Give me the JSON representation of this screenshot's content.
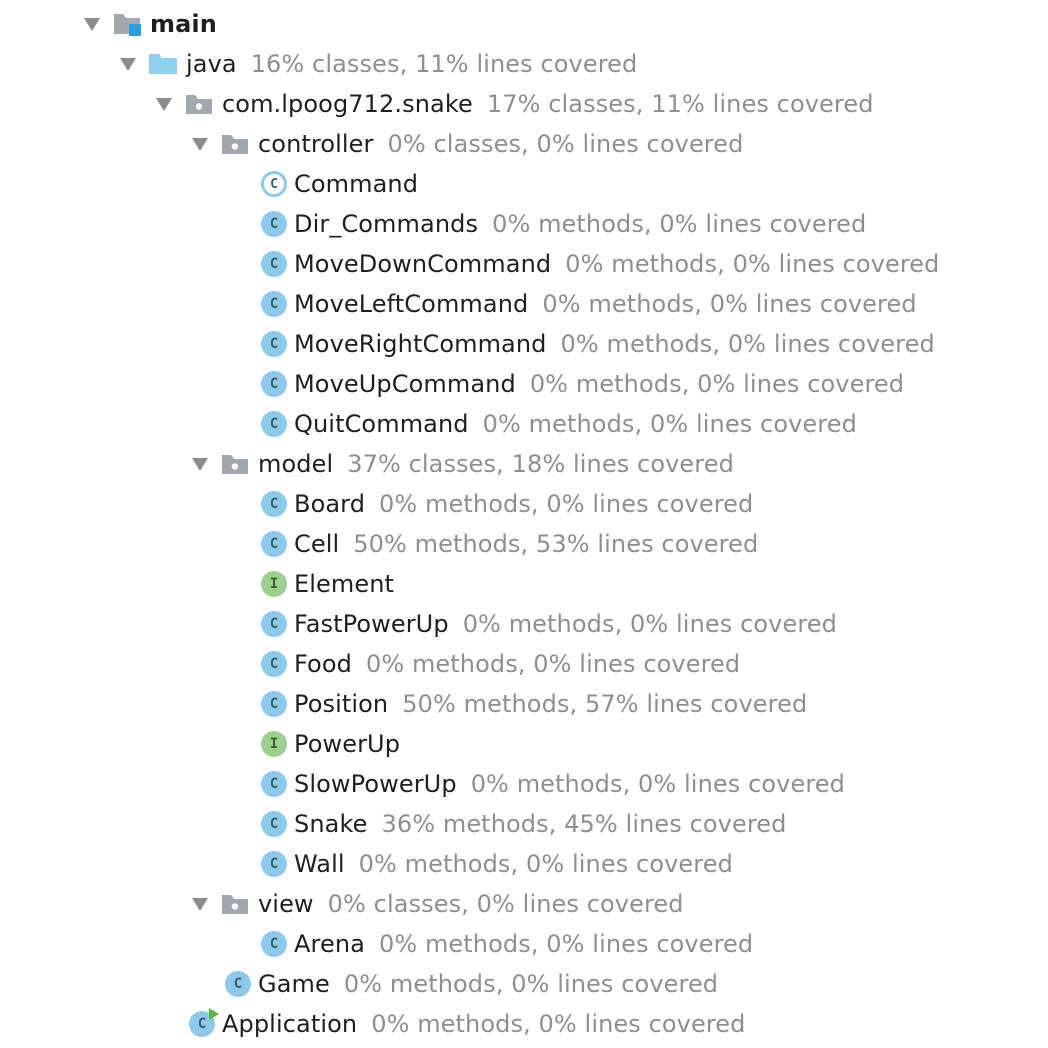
{
  "tree": [
    {
      "level": 0,
      "expanded": true,
      "icon": "module-folder-icon",
      "name": "main",
      "bold": true,
      "coverage": ""
    },
    {
      "level": 1,
      "expanded": true,
      "icon": "source-folder-icon",
      "name": "java",
      "coverage": "16% classes, 11% lines covered"
    },
    {
      "level": 2,
      "expanded": true,
      "icon": "package-icon",
      "name": "com.lpoog712.snake",
      "coverage": "17% classes, 11% lines covered"
    },
    {
      "level": 3,
      "expanded": true,
      "icon": "package-icon",
      "name": "controller",
      "coverage": "0% classes, 0% lines covered"
    },
    {
      "level": 4,
      "icon": "abstract-class-icon",
      "name": "Command",
      "coverage": ""
    },
    {
      "level": 4,
      "icon": "class-icon",
      "name": "Dir_Commands",
      "coverage": "0% methods, 0% lines covered"
    },
    {
      "level": 4,
      "icon": "class-icon",
      "name": "MoveDownCommand",
      "coverage": "0% methods, 0% lines covered"
    },
    {
      "level": 4,
      "icon": "class-icon",
      "name": "MoveLeftCommand",
      "coverage": "0% methods, 0% lines covered"
    },
    {
      "level": 4,
      "icon": "class-icon",
      "name": "MoveRightCommand",
      "coverage": "0% methods, 0% lines covered"
    },
    {
      "level": 4,
      "icon": "class-icon",
      "name": "MoveUpCommand",
      "coverage": "0% methods, 0% lines covered"
    },
    {
      "level": 4,
      "icon": "class-icon",
      "name": "QuitCommand",
      "coverage": "0% methods, 0% lines covered"
    },
    {
      "level": 3,
      "expanded": true,
      "icon": "package-icon",
      "name": "model",
      "coverage": "37% classes, 18% lines covered"
    },
    {
      "level": 4,
      "icon": "class-icon",
      "name": "Board",
      "coverage": "0% methods, 0% lines covered"
    },
    {
      "level": 4,
      "icon": "class-icon",
      "name": "Cell",
      "coverage": "50% methods, 53% lines covered"
    },
    {
      "level": 4,
      "icon": "interface-icon",
      "name": "Element",
      "coverage": ""
    },
    {
      "level": 4,
      "icon": "class-icon",
      "name": "FastPowerUp",
      "coverage": "0% methods, 0% lines covered"
    },
    {
      "level": 4,
      "icon": "class-icon",
      "name": "Food",
      "coverage": "0% methods, 0% lines covered"
    },
    {
      "level": 4,
      "icon": "class-icon",
      "name": "Position",
      "coverage": "50% methods, 57% lines covered"
    },
    {
      "level": 4,
      "icon": "interface-icon",
      "name": "PowerUp",
      "coverage": ""
    },
    {
      "level": 4,
      "icon": "class-icon",
      "name": "SlowPowerUp",
      "coverage": "0% methods, 0% lines covered"
    },
    {
      "level": 4,
      "icon": "class-icon",
      "name": "Snake",
      "coverage": "36% methods, 45% lines covered"
    },
    {
      "level": 4,
      "icon": "class-icon",
      "name": "Wall",
      "coverage": "0% methods, 0% lines covered"
    },
    {
      "level": 3,
      "expanded": true,
      "icon": "package-icon",
      "name": "view",
      "coverage": "0% classes, 0% lines covered"
    },
    {
      "level": 4,
      "icon": "class-icon",
      "name": "Arena",
      "coverage": "0% methods, 0% lines covered"
    },
    {
      "level": 3,
      "icon": "class-icon",
      "name": "Game",
      "coverage": "0% methods, 0% lines covered"
    },
    {
      "level": 2,
      "icon": "runnable-class-icon",
      "name": "Application",
      "coverage": "0% methods, 0% lines covered"
    }
  ],
  "icon_letters": {
    "class": "C",
    "interface": "I"
  },
  "colors": {
    "class_icon": "#8cc9ea",
    "interface_icon": "#9ecf8e",
    "folder_grey": "#a2a8ae",
    "source_folder_blue": "#8fd0ef",
    "run_marker": "#5bb83a",
    "coverage_text": "#8f8f8f",
    "name_text": "#1f1f1f"
  }
}
